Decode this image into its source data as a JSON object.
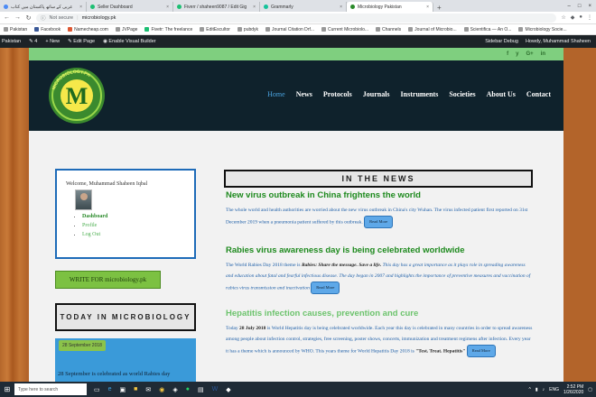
{
  "browser": {
    "tabs": [
      {
        "title": "عربی کے ساتھ پاکستان میں کتاب"
      },
      {
        "title": "Seller Dashboard"
      },
      {
        "title": "Fiverr / shaheen9087 / Edit Gig"
      },
      {
        "title": "Grammarly"
      },
      {
        "title": "Microbiology Pakistan"
      }
    ],
    "security_label": "Not secure",
    "url": "microbiology.pk",
    "bookmarks": [
      "Pakistan",
      "Facebook",
      "Namecheap.com",
      "JVPage",
      "Fivetr: The freelance",
      "EditEscultor",
      "pubdyk",
      "Journal Citation Drf...",
      "Current Microbiolo...",
      "Channels",
      "Journal of Microbio...",
      "Scientifica — An O...",
      "Microbiology Socie..."
    ],
    "wp_admin": {
      "site": "Pakistan",
      "comments": "4",
      "new": "New",
      "edit_page": "Edit Page",
      "visual_builder": "Enable Visual Builder",
      "sidebar_debug": "Sidebar Debug",
      "howdy": "Howdy, Muhammad Shaheen"
    }
  },
  "site": {
    "social": [
      "f",
      "y",
      "G+",
      "in"
    ],
    "logo_text": "MICROBIOLOGY.PK",
    "logo_letter": "M",
    "nav": [
      "Home",
      "News",
      "Protocols",
      "Journals",
      "Instruments",
      "Societies",
      "About Us",
      "Contact"
    ],
    "login": {
      "welcome": "Welcome, Muhammad Shaheen Iqbal",
      "links": [
        "Dashboard",
        "Profile",
        "Log Out"
      ]
    },
    "write_button": "WRITE FOR microbiology.pk",
    "today_title": "TODAY IN MICROBIOLOGY",
    "today_date": "28 September 2018",
    "today_text": "28 September is celebrated as world Rabies day",
    "news_title": "IN THE NEWS",
    "articles": [
      {
        "title": "New virus outbreak in China frightens the world",
        "body": "The whole world and health authorities are worried about the new virus outbreak in China's city Wuhan. The virus infected patient first reported on 31st December 2019 when a pneumonia patient suffered by this outbreak.",
        "more": "Read More"
      },
      {
        "title": "Rabies virus awareness day is being celebrated worldwide",
        "body_pre": "The World Rabies Day 2018 theme is ",
        "body_em": "Rabies: Share the message. Save a life.",
        "body_post": " This day has a great importance as it plays role in spreading awareness and education about fatal and fearful infectious disease. The day began in 2007 and highlights the importance of preventive measures and vaccination of rabies virus transmission and inactivation",
        "more": "Read More"
      },
      {
        "title": "Hepatitis infection causes, prevention and cure",
        "body_pre": "Today ",
        "body_em": "28 July 2018",
        "body_post": " is World Hepatitis day is being celebrated worldwide. Each year this day is celebrated in many countries in order to spread awareness among people about infection control, strategies, free screening, poster shows, concerts, immunization and treatment regimens after infection. Every year it has a theme which is announced by WHO. This years theme for World Hepatitis Day 2018 is ",
        "body_quote": "\"Test. Treat. Hepatitis\"",
        "more": "Read More"
      }
    ]
  },
  "taskbar": {
    "search_placeholder": "Type here to search",
    "time": "2:52 PM",
    "date": "1/26/2020",
    "lang": "ENG"
  }
}
